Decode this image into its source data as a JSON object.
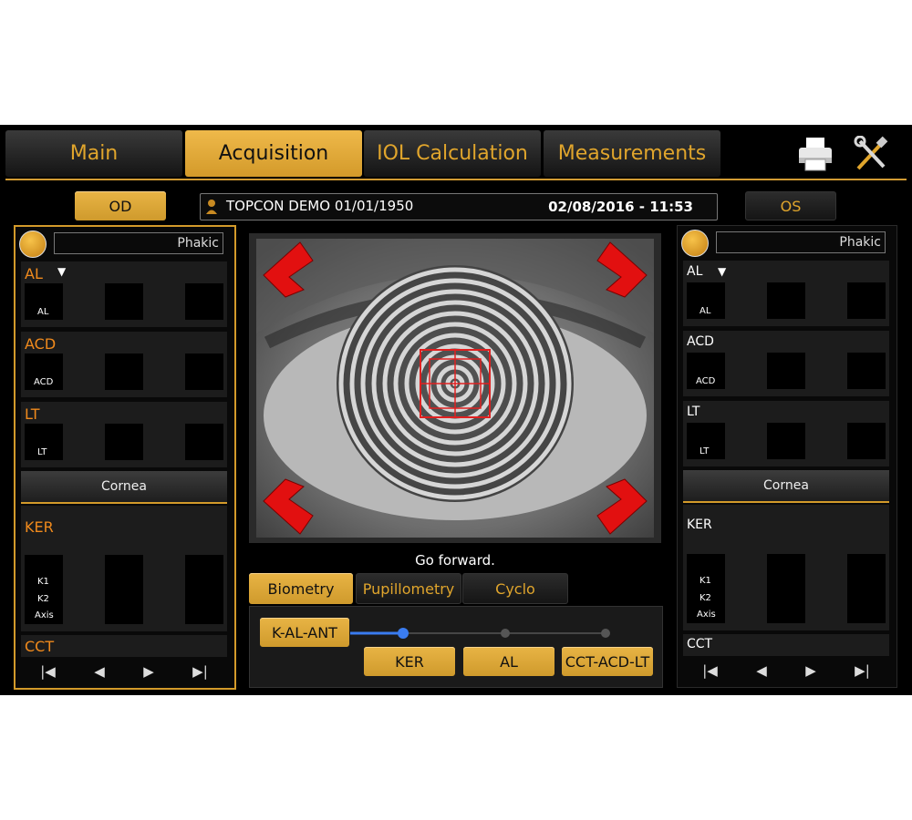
{
  "tabs": [
    {
      "label": "Main",
      "active": false
    },
    {
      "label": "Acquisition",
      "active": true
    },
    {
      "label": "IOL Calculation",
      "active": false
    },
    {
      "label": "Measurements",
      "active": false
    }
  ],
  "toolbar": {
    "print_icon": "printer-icon",
    "settings_icon": "tools-icon"
  },
  "eyes": {
    "od_label": "OD",
    "os_label": "OS"
  },
  "patient": {
    "name": "TOPCON DEMO 01/01/1950",
    "datetime": "02/08/2016 - 11:53"
  },
  "left_panel": {
    "lens_status": "Phakic",
    "al_title": "AL",
    "al_label": "AL",
    "acd_title": "ACD",
    "acd_label": "ACD",
    "lt_title": "LT",
    "lt_label": "LT",
    "cornea_label": "Cornea",
    "ker_title": "KER",
    "k1_label": "K1",
    "k2_label": "K2",
    "axis_label": "Axis",
    "cct_title": "CCT"
  },
  "right_panel": {
    "lens_status": "Phakic",
    "al_title": "AL",
    "al_label": "AL",
    "acd_title": "ACD",
    "acd_label": "ACD",
    "lt_title": "LT",
    "lt_label": "LT",
    "cornea_label": "Cornea",
    "ker_title": "KER",
    "k1_label": "K1",
    "k2_label": "K2",
    "axis_label": "Axis",
    "cct_title": "CCT"
  },
  "nav": {
    "first": "|◀",
    "prev": "◀",
    "next": "▶",
    "last": "▶|"
  },
  "status_message": "Go forward.",
  "mode_tabs": [
    {
      "label": "Biometry",
      "active": true
    },
    {
      "label": "Pupillometry",
      "active": false
    },
    {
      "label": "Cyclo",
      "active": false
    }
  ],
  "sequence": {
    "main_label": "K-AL-ANT",
    "steps": [
      "KER",
      "AL",
      "CCT-ACD-LT"
    ]
  },
  "colors": {
    "accent": "#d39a2a",
    "active_text": "#f08a1c",
    "progress": "#3a7cf0"
  }
}
